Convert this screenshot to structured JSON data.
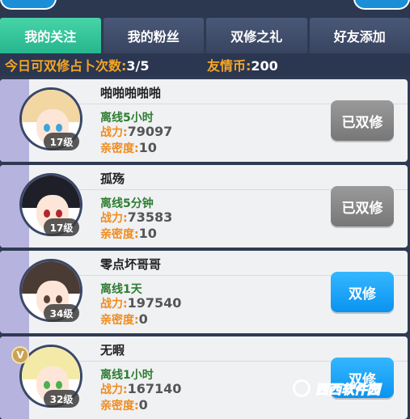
{
  "tabs": [
    {
      "label": "我的关注",
      "active": true
    },
    {
      "label": "我的粉丝",
      "active": false
    },
    {
      "label": "双修之礼",
      "active": false
    },
    {
      "label": "好友添加",
      "active": false
    }
  ],
  "info": {
    "quota_label": "今日可双修占卜次数:",
    "quota_value": "3/5",
    "coin_label": "友情币:",
    "coin_value": "200"
  },
  "friends": [
    {
      "name": "啪啪啪啪啪",
      "level": "17级",
      "status": "离线5小时",
      "power_label": "战力:",
      "power": "79097",
      "intimacy_label": "亲密度:",
      "intimacy": "10",
      "button": "已双修",
      "button_state": "done",
      "vip": false,
      "hair_color": "#f2d7a2",
      "eye_color": "#3aa6d8"
    },
    {
      "name": "孤殇",
      "level": "17级",
      "status": "离线5分钟",
      "power_label": "战力:",
      "power": "73583",
      "intimacy_label": "亲密度:",
      "intimacy": "10",
      "button": "已双修",
      "button_state": "done",
      "vip": false,
      "hair_color": "#1f1f2a",
      "eye_color": "#b3262a"
    },
    {
      "name": "零点坏哥哥",
      "level": "34级",
      "status": "离线1天",
      "power_label": "战力:",
      "power": "197540",
      "intimacy_label": "亲密度:",
      "intimacy": "0",
      "button": "双修",
      "button_state": "go",
      "vip": false,
      "hair_color": "#4a3b35",
      "eye_color": "#5b4035"
    },
    {
      "name": "无暇",
      "level": "32级",
      "status": "离线1小时",
      "power_label": "战力:",
      "power": "167140",
      "intimacy_label": "亲密度:",
      "intimacy": "0",
      "button": "双修",
      "button_state": "go",
      "vip": true,
      "vip_label": "V",
      "hair_color": "#f4eaa8",
      "eye_color": "#4caf50"
    }
  ],
  "watermark": {
    "text": "西西软件园"
  }
}
